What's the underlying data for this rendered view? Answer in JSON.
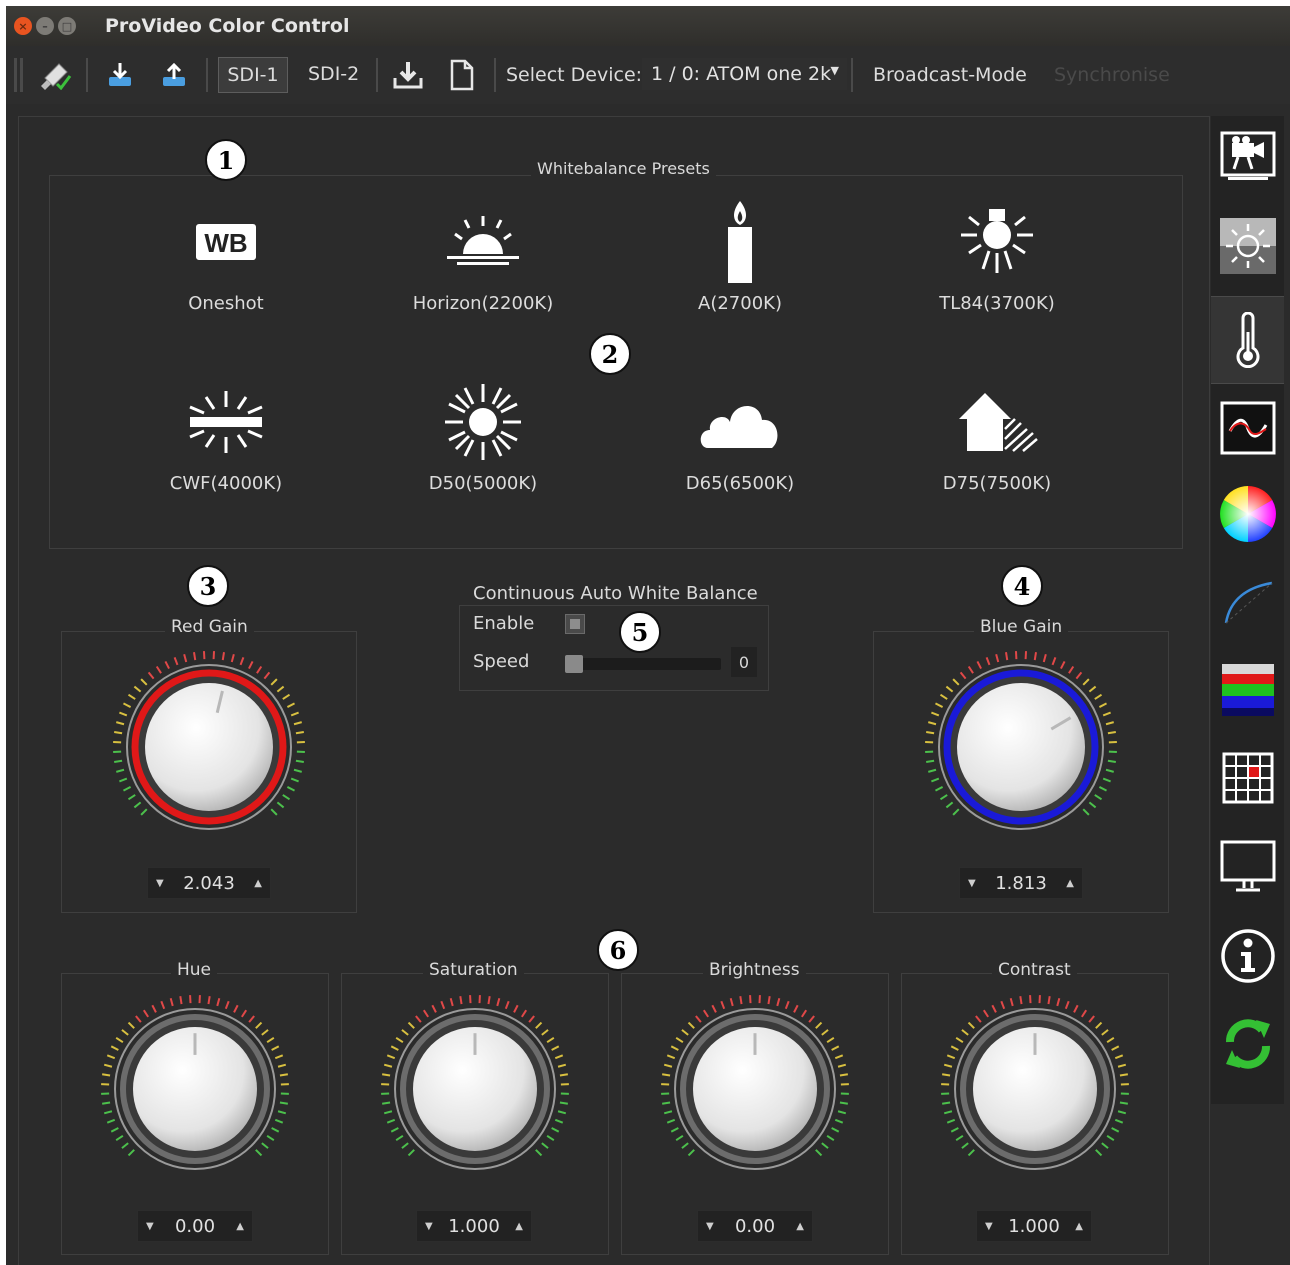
{
  "window": {
    "title": "ProVideo Color Control"
  },
  "toolbar": {
    "sdi1": "SDI-1",
    "sdi2": "SDI-2",
    "select_device_label": "Select Device:",
    "device_value": "1 / 0: ATOM one 2k",
    "broadcast_mode": "Broadcast-Mode",
    "synchronise": "Synchronise",
    "icons": [
      "wipe-icon",
      "download-blue-icon",
      "upload-blue-icon",
      "save-icon",
      "new-file-icon"
    ]
  },
  "presets": {
    "title": "Whitebalance Presets",
    "items": [
      {
        "label": "Oneshot",
        "icon": "wb-icon"
      },
      {
        "label": "Horizon(2200K)",
        "icon": "sunrise-icon"
      },
      {
        "label": "A(2700K)",
        "icon": "candle-icon"
      },
      {
        "label": "TL84(3700K)",
        "icon": "lamp-icon"
      },
      {
        "label": "CWF(4000K)",
        "icon": "fluorescent-icon"
      },
      {
        "label": "D50(5000K)",
        "icon": "sun-icon"
      },
      {
        "label": "D65(6500K)",
        "icon": "cloud-icon"
      },
      {
        "label": "D75(7500K)",
        "icon": "house-shade-icon"
      }
    ]
  },
  "red_gain": {
    "title": "Red Gain",
    "value": "2.043",
    "level": 0.55,
    "accent": "#e01818"
  },
  "blue_gain": {
    "title": "Blue Gain",
    "value": "1.813",
    "level": 0.72,
    "accent": "#1a1ad8"
  },
  "cawb": {
    "title": "Continuous Auto White Balance",
    "enable_label": "Enable",
    "enabled": false,
    "speed_label": "Speed",
    "speed_value": "0"
  },
  "hue": {
    "title": "Hue",
    "value": "0.00"
  },
  "saturation": {
    "title": "Saturation",
    "value": "1.000"
  },
  "brightness": {
    "title": "Brightness",
    "value": "0.00"
  },
  "contrast": {
    "title": "Contrast",
    "value": "1.000"
  },
  "badges": [
    "1",
    "2",
    "3",
    "4",
    "5",
    "6"
  ],
  "sidebar": {
    "items": [
      "camera-icon",
      "brightness-icon",
      "thermometer-icon",
      "waveform-icon",
      "color-wheel-icon",
      "curve-icon",
      "color-bars-icon",
      "grid-icon",
      "monitor-icon",
      "info-icon",
      "refresh-icon"
    ],
    "active": "thermometer-icon"
  }
}
